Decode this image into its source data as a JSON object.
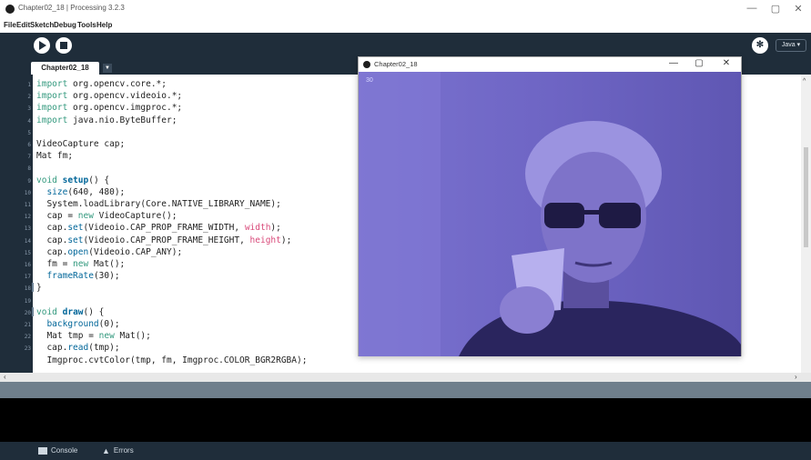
{
  "window": {
    "title": "Chapter02_18 | Processing 3.2.3",
    "controls": [
      "—",
      "▢",
      "✕"
    ]
  },
  "menu": [
    "File",
    "Edit",
    "Sketch",
    "Debug",
    "Tools",
    "Help"
  ],
  "toolbar": {
    "mode": "Java ▾"
  },
  "tab": {
    "name": "Chapter02_18"
  },
  "code": [
    "import org.opencv.core.*;",
    "import org.opencv.videoio.*;",
    "import org.opencv.imgproc.*;",
    "import java.nio.ByteBuffer;",
    "",
    "VideoCapture cap;",
    "Mat fm;",
    "",
    "void setup() {",
    "  size(640, 480);",
    "  System.loadLibrary(Core.NATIVE_LIBRARY_NAME);",
    "  cap = new VideoCapture();",
    "  cap.set(Videoio.CAP_PROP_FRAME_WIDTH, width);",
    "  cap.set(Videoio.CAP_PROP_FRAME_HEIGHT, height);",
    "  cap.open(Videoio.CAP_ANY);",
    "  fm = new Mat();",
    "  frameRate(30);",
    "}",
    "",
    "void draw() {",
    "  background(0);",
    "  Mat tmp = new Mat();",
    "  cap.read(tmp);",
    "  Imgproc.cvtColor(tmp, fm, Imgproc.COLOR_BGR2RGBA);"
  ],
  "line_numbers": [
    "1",
    "2",
    "3",
    "4",
    "5",
    "6",
    "7",
    "8",
    "9",
    "10",
    "11",
    "12",
    "13",
    "14",
    "15",
    "16",
    "17",
    "18",
    "19",
    "20",
    "21",
    "22",
    "23"
  ],
  "sketch_window": {
    "title": "Chapter02_18",
    "fps": "30",
    "controls": [
      "—",
      "▢",
      "✕"
    ]
  },
  "footer": {
    "console": "Console",
    "errors": "Errors"
  },
  "colors": {
    "toolbar": "#1f2d3a",
    "keyword": "#33997e",
    "function": "#006699",
    "type": "#e2661a",
    "camera_tint": "#6a5fc2"
  }
}
